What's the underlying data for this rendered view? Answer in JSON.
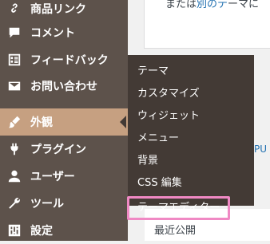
{
  "sidebar": {
    "items": [
      {
        "label": "商品リンク",
        "icon": "link-icon"
      },
      {
        "label": "コメント",
        "icon": "comment-icon"
      },
      {
        "label": "フィードバック",
        "icon": "feedback-icon"
      },
      {
        "label": "お問い合わせ",
        "icon": "mail-icon"
      },
      {
        "label": "外観",
        "icon": "appearance-brush-icon",
        "active": true
      },
      {
        "label": "プラグイン",
        "icon": "plugin-icon"
      },
      {
        "label": "ユーザー",
        "icon": "user-icon"
      },
      {
        "label": "ツール",
        "icon": "wrench-icon"
      },
      {
        "label": "設定",
        "icon": "settings-icon"
      }
    ]
  },
  "submenu": {
    "items": [
      {
        "label": "テーマ"
      },
      {
        "label": "カスタマイズ"
      },
      {
        "label": "ウィジェット"
      },
      {
        "label": "メニュー"
      },
      {
        "label": "背景"
      },
      {
        "label": "CSS 編集"
      },
      {
        "label": "テーマエディター",
        "highlighted": true
      }
    ]
  },
  "main": {
    "top_text_prefix": "または",
    "top_text_link": "別のテ",
    "top_text_suffix": "ーマに",
    "partial_link": "PU",
    "partial_text": "最近公開"
  },
  "colors": {
    "sidebar_bg": "#5d524b",
    "submenu_bg": "#433a35",
    "active_bg": "#c6a081",
    "highlight_border": "#f089c4",
    "link": "#2271b1"
  }
}
